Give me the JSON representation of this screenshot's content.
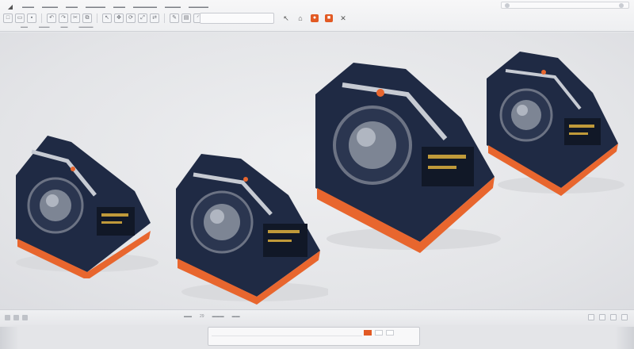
{
  "colors": {
    "body_dark": "#1f2a44",
    "accent_orange": "#e8662e",
    "lens_gray": "#7d8594",
    "background": "#e6e7ea"
  },
  "toolbar": {
    "logo_icon": "app-logo-icon",
    "right_icons": [
      "pointer-icon",
      "tag-icon",
      "record-icon",
      "camera-icon",
      "close-icon"
    ]
  },
  "status": {
    "zoom_text": "29"
  },
  "models": [
    {
      "name": "camera-model-1"
    },
    {
      "name": "camera-model-2"
    },
    {
      "name": "camera-model-3"
    },
    {
      "name": "camera-model-4"
    }
  ]
}
